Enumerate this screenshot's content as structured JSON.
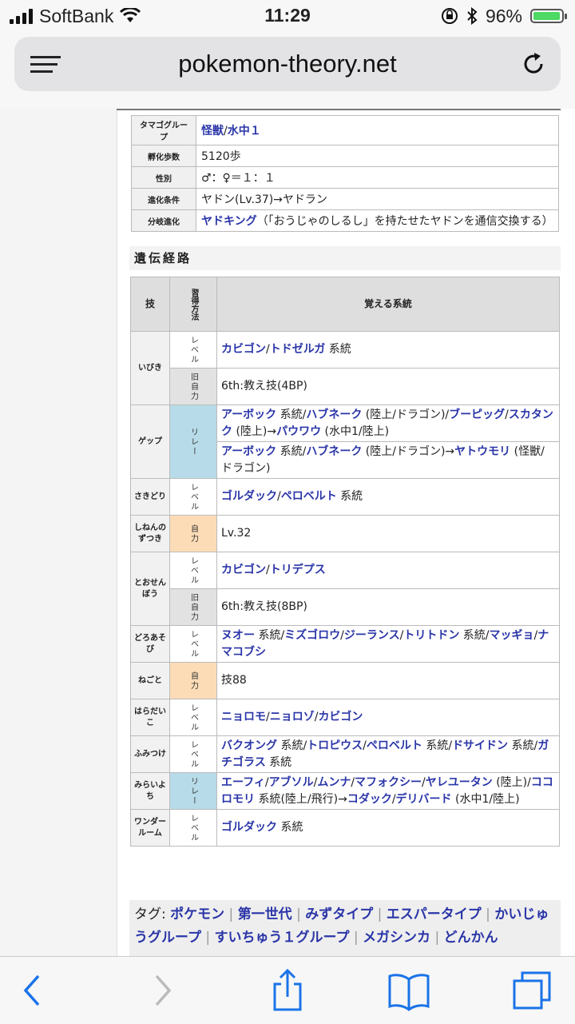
{
  "status": {
    "carrier": "SoftBank",
    "time": "11:29",
    "battery": "96%",
    "battery_level": 0.96
  },
  "browser": {
    "url": "pokemon-theory.net"
  },
  "info_table": [
    {
      "label": "タマゴグループ",
      "links": [
        "怪獣",
        "水中１"
      ],
      "seps": [
        "/"
      ]
    },
    {
      "label": "孵化歩数",
      "text": "5120歩"
    },
    {
      "label": "性別",
      "text": "♂：♀＝１：１"
    },
    {
      "label": "進化条件",
      "text": "ヤドン(Lv.37)→ヤドラン"
    },
    {
      "label": "分岐進化",
      "link": "ヤドキング",
      "text": "（「おうじゃのしるし」を持たせたヤドンを通信交換する）"
    }
  ],
  "section_title": "遺伝経路",
  "moves_header": {
    "move": "技",
    "method": "習得方法",
    "lineage": "覚える系統"
  },
  "moves": [
    {
      "name": "いびき",
      "rows": [
        {
          "method": "レベル",
          "type": "level",
          "parts": [
            {
              "l": "カビゴン"
            },
            {
              "t": "/"
            },
            {
              "l": "トドゼルガ"
            },
            {
              "t": " 系統"
            }
          ]
        },
        {
          "method": "旧自力",
          "type": "old",
          "parts": [
            {
              "t": "6th:教え技(4BP)"
            }
          ]
        }
      ]
    },
    {
      "name": "ゲップ",
      "rows": [
        {
          "method": "リレー",
          "type": "relay",
          "span": 2,
          "parts": [
            {
              "l": "アーボック"
            },
            {
              "t": " 系統/"
            },
            {
              "l": "ハブネーク"
            },
            {
              "t": " (陸上/ドラゴン)/"
            },
            {
              "l": "ブーピッグ"
            },
            {
              "t": "/"
            },
            {
              "l": "スカタンク"
            },
            {
              "t": " (陸上)→"
            },
            {
              "l": "パウワウ"
            },
            {
              "t": " (水中1/陸上)"
            }
          ]
        },
        {
          "method": "",
          "type": "none",
          "parts": [
            {
              "l": "アーボック"
            },
            {
              "t": " 系統/"
            },
            {
              "l": "ハブネーク"
            },
            {
              "t": " (陸上/ドラゴン)→"
            },
            {
              "l": "ヤトウモリ"
            },
            {
              "t": " (怪獣/ドラゴン)"
            }
          ]
        }
      ]
    },
    {
      "name": "さきどり",
      "rows": [
        {
          "method": "レベル",
          "type": "level",
          "parts": [
            {
              "l": "ゴルダック"
            },
            {
              "t": "/"
            },
            {
              "l": "ペロベルト"
            },
            {
              "t": " 系統"
            }
          ]
        }
      ]
    },
    {
      "name": "しねんのずつき",
      "rows": [
        {
          "method": "自力",
          "type": "jiriki",
          "parts": [
            {
              "t": "Lv.32"
            }
          ]
        }
      ]
    },
    {
      "name": "とおせんぼう",
      "rows": [
        {
          "method": "レベル",
          "type": "level",
          "parts": [
            {
              "l": "カビゴン"
            },
            {
              "t": "/"
            },
            {
              "l": "トリデプス"
            }
          ]
        },
        {
          "method": "旧自力",
          "type": "old",
          "parts": [
            {
              "t": "6th:教え技(8BP)"
            }
          ]
        }
      ]
    },
    {
      "name": "どろあそび",
      "rows": [
        {
          "method": "レベル",
          "type": "level",
          "parts": [
            {
              "l": "ヌオー"
            },
            {
              "t": " 系統/"
            },
            {
              "l": "ミズゴロウ"
            },
            {
              "t": "/"
            },
            {
              "l": "ジーランス"
            },
            {
              "t": "/"
            },
            {
              "l": "トリトドン"
            },
            {
              "t": " 系統/"
            },
            {
              "l": "マッギョ"
            },
            {
              "t": "/"
            },
            {
              "l": "ナマコブシ"
            }
          ]
        }
      ]
    },
    {
      "name": "ねごと",
      "rows": [
        {
          "method": "自力",
          "type": "jiriki",
          "parts": [
            {
              "t": "技88"
            }
          ]
        }
      ]
    },
    {
      "name": "はらだいこ",
      "rows": [
        {
          "method": "レベル",
          "type": "level",
          "parts": [
            {
              "l": "ニョロモ"
            },
            {
              "t": "/"
            },
            {
              "l": "ニョロゾ"
            },
            {
              "t": "/"
            },
            {
              "l": "カビゴン"
            }
          ]
        }
      ]
    },
    {
      "name": "ふみつけ",
      "rows": [
        {
          "method": "レベル",
          "type": "level",
          "parts": [
            {
              "l": "バクオング"
            },
            {
              "t": " 系統/"
            },
            {
              "l": "トロピウス"
            },
            {
              "t": "/"
            },
            {
              "l": "ペロベルト"
            },
            {
              "t": " 系統/"
            },
            {
              "l": "ドサイドン"
            },
            {
              "t": " 系統/"
            },
            {
              "l": "ガチゴラス"
            },
            {
              "t": " 系統"
            }
          ]
        }
      ]
    },
    {
      "name": "みらいよち",
      "rows": [
        {
          "method": "リレー",
          "type": "relay",
          "parts": [
            {
              "l": "エーフィ"
            },
            {
              "t": "/"
            },
            {
              "l": "アブソル"
            },
            {
              "t": "/"
            },
            {
              "l": "ムンナ"
            },
            {
              "t": "/"
            },
            {
              "l": "マフォクシー"
            },
            {
              "t": "/"
            },
            {
              "l": "ヤレユータン"
            },
            {
              "t": " (陸上)/"
            },
            {
              "l": "ココロモリ"
            },
            {
              "t": " 系統(陸上/飛行)→"
            },
            {
              "l": "コダック"
            },
            {
              "t": "/"
            },
            {
              "l": "デリバード"
            },
            {
              "t": " (水中1/陸上)"
            }
          ]
        }
      ]
    },
    {
      "name": "ワンダールーム",
      "rows": [
        {
          "method": "レベル",
          "type": "level",
          "parts": [
            {
              "l": "ゴルダック"
            },
            {
              "t": " 系統"
            }
          ]
        }
      ]
    }
  ],
  "tags": {
    "label": "タグ:",
    "items": [
      "ポケモン",
      "第一世代",
      "みずタイプ",
      "エスパータイプ",
      "かいじゅうグループ",
      "すいちゅう１グループ",
      "メガシンカ",
      "どんかん"
    ]
  }
}
